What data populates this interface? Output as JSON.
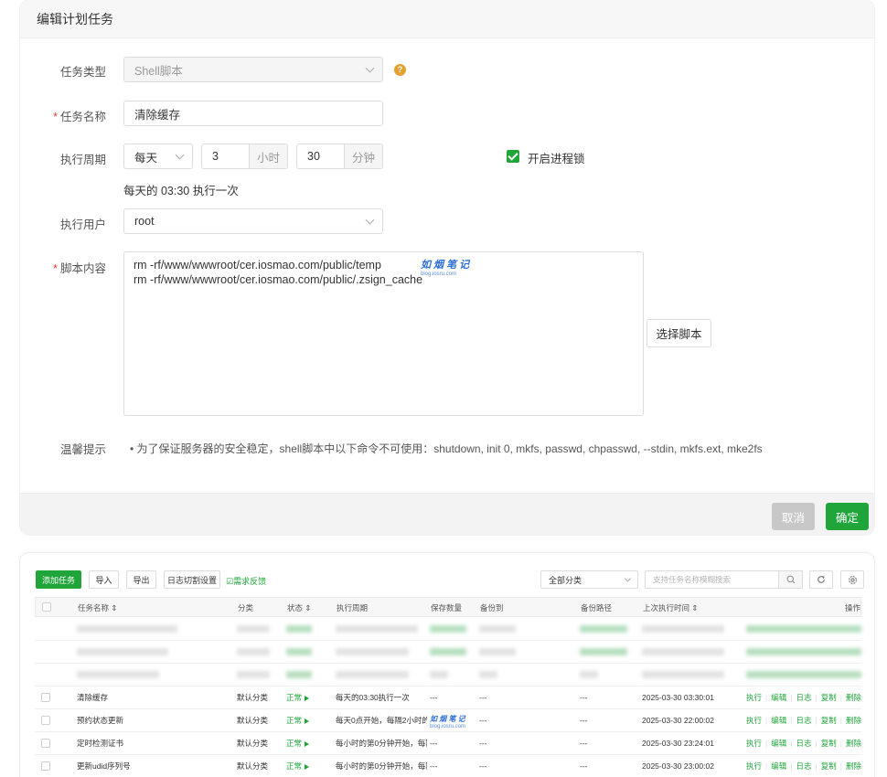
{
  "dialog": {
    "title": "编辑计划任务",
    "task_type": {
      "label": "任务类型",
      "value": "Shell脚本",
      "help": "?"
    },
    "task_name": {
      "required": "*",
      "label": "任务名称",
      "value": "清除缓存"
    },
    "period": {
      "label": "执行周期",
      "unit_select": "每天",
      "hour_value": "3",
      "hour_suffix": "小时",
      "minute_value": "30",
      "minute_suffix": "分钟",
      "lock_label": "开启进程锁",
      "lock_checked": true,
      "summary": "每天的 03:30 执行一次"
    },
    "user": {
      "label": "执行用户",
      "value": "root"
    },
    "script": {
      "required": "*",
      "label": "脚本内容",
      "lines": [
        "rm -rf/www/wwwroot/cer.iosmao.com/public/temp",
        "rm -rf/www/wwwroot/cer.iosmao.com/public/.zsign_cache"
      ],
      "choose_button": "选择脚本"
    },
    "tip": {
      "label": "温馨提示",
      "text": "• 为了保证服务器的安全稳定，shell脚本中以下命令不可使用：shutdown, init 0, mkfs, passwd, chpasswd, --stdin, mkfs.ext, mke2fs"
    },
    "watermark": {
      "title": "如 烟 笔 记",
      "sub": "blog.iosru.com"
    },
    "footer": {
      "cancel": "取消",
      "confirm": "确定"
    }
  },
  "panel": {
    "toolbar": {
      "add": "添加任务",
      "import": "导入",
      "export": "导出",
      "log_cut": "日志切割设置",
      "feedback": "需求反馈",
      "category_select": "全部分类",
      "search_placeholder": "支持任务名称模糊搜索"
    },
    "headers": {
      "name": "任务名称 ⇕",
      "category": "分类",
      "status": "状态 ⇕",
      "period": "执行周期",
      "keep": "保存数量",
      "backup_to": "备份到",
      "backup_path": "备份路径",
      "last_run": "上次执行时间 ⇕",
      "ops": "操作"
    },
    "ops": {
      "run": "执行",
      "edit": "编辑",
      "log": "日志",
      "copy": "复制",
      "delete": "删除"
    },
    "rows": [
      {
        "name": "清除缓存",
        "category": "默认分类",
        "status": "正常",
        "period": "每天的03:30执行一次",
        "keep": "---",
        "backup_to": "---",
        "backup_path": "---",
        "last_run": "2025-03-30 03:30:01"
      },
      {
        "name": "预约状态更新",
        "category": "默认分类",
        "status": "正常",
        "period": "每天0点开始，每隔2小时的",
        "keep": "---",
        "backup_to": "",
        "backup_path": "---",
        "last_run": "2025-03-30 22:00:02"
      },
      {
        "name": "定时检测证书",
        "category": "默认分类",
        "status": "正常",
        "period": "每小时的第0分钟开始，每隔",
        "keep": "---",
        "backup_to": "---",
        "backup_path": "---",
        "last_run": "2025-03-30 23:24:01"
      },
      {
        "name": "更新udid序列号",
        "category": "默认分类",
        "status": "正常",
        "period": "每小时的第0分钟开始，每隔",
        "keep": "---",
        "backup_to": "---",
        "backup_path": "---",
        "last_run": "2025-03-30 23:00:02"
      }
    ]
  }
}
